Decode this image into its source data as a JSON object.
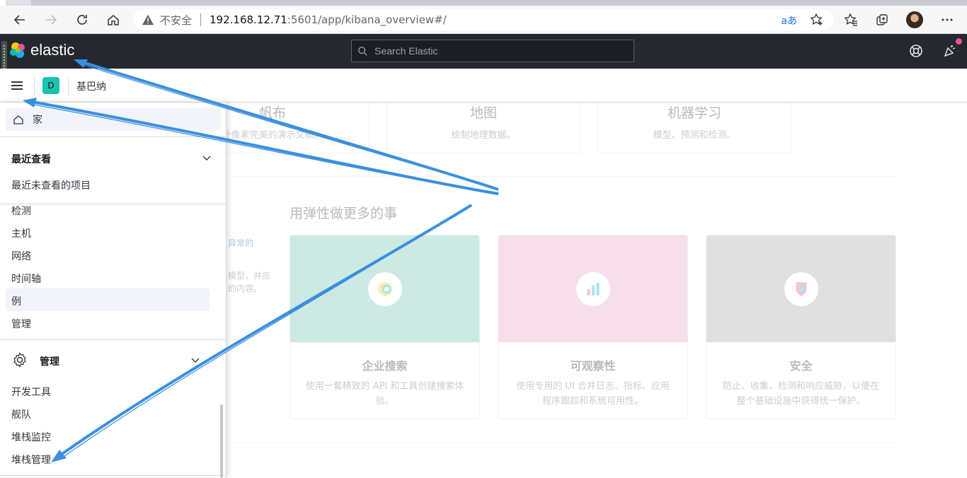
{
  "browser": {
    "insecure_label": "不安全",
    "url_host": "192.168.12.71",
    "url_path": ":5601/app/kibana_overview#/",
    "translate_glyph": "aあ"
  },
  "header": {
    "logo_text": "elastic",
    "search_placeholder": "Search Elastic"
  },
  "breadcrumb": {
    "space_initial": "D",
    "current": "基巴纳"
  },
  "nav": {
    "home_label": "家",
    "recent": {
      "title": "最近查看",
      "empty": "最近未查看的项目"
    },
    "security_items": [
      "检测",
      "主机",
      "网络",
      "时间轴",
      "例",
      "管理"
    ],
    "management": {
      "title": "管理",
      "items": [
        "开发工具",
        "舰队",
        "堆栈监控",
        "堆栈管理"
      ]
    }
  },
  "main": {
    "top_cards": [
      {
        "title": "帆布",
        "desc": "计像素完美的演示文稿。"
      },
      {
        "title": "地图",
        "desc": "绘制地理数据。"
      },
      {
        "title": "机器学习",
        "desc": "模型、预测和检测。"
      }
    ],
    "section_title": "用弹性做更多的事",
    "side_fragments": [
      "异常的",
      "模型，并应",
      "的内容。"
    ],
    "solutions": [
      {
        "title": "企业搜索",
        "desc": "使用一套精致的 API 和工具创建搜索体验。",
        "color": "#6dc1b3"
      },
      {
        "title": "可观察性",
        "desc": "使用专用的 UI 合并日志、指标、应用程序跟踪和系统可用性。",
        "color": "#e9a1c6"
      },
      {
        "title": "安全",
        "desc": "防止、收集、检测和响应威胁，以便在整个基础设施中获得统一保护。",
        "color": "#a6a6a6"
      }
    ]
  },
  "colors": {
    "header_bg": "#25282f",
    "arrow": "#3b8fe0",
    "space_avatar": "#1bc2b0"
  }
}
